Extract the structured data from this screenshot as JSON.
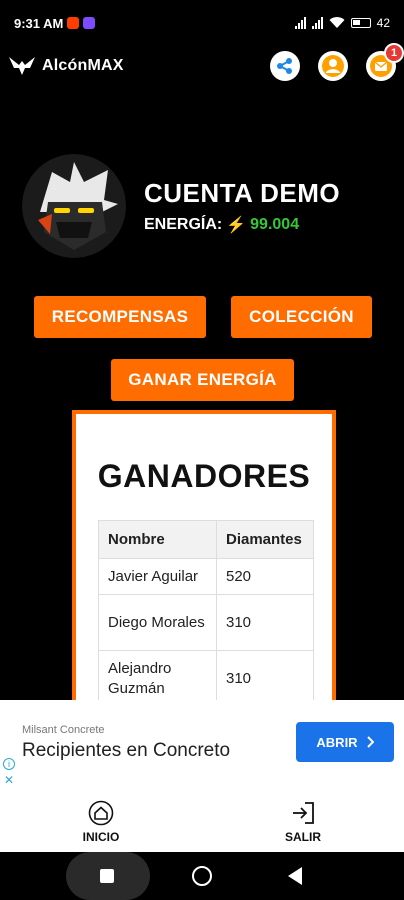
{
  "status_bar": {
    "time": "9:31 AM",
    "battery": "42"
  },
  "header": {
    "app_name": "AlcónMAX",
    "notification_count": "1"
  },
  "profile": {
    "name": "CUENTA DEMO",
    "energy_label": "ENERGÍA:",
    "energy_value": "99.004"
  },
  "buttons": {
    "rewards": "RECOMPENSAS",
    "collection": "COLECCIÓN",
    "earn_energy": "GANAR ENERGÍA"
  },
  "winners": {
    "title": "GANADORES",
    "columns": [
      "Nombre",
      "Diamantes"
    ],
    "rows": [
      {
        "name": "Javier Aguilar",
        "diamonds": "520"
      },
      {
        "name": "Diego Morales",
        "diamonds": "310"
      },
      {
        "name": "Alejandro Guzmán",
        "diamonds": "310"
      }
    ]
  },
  "ad": {
    "advertiser": "Milsant Concrete",
    "headline": "Recipientes en Concreto",
    "cta": "ABRIR"
  },
  "bottom_nav": {
    "home": "INICIO",
    "exit": "SALIR"
  },
  "colors": {
    "accent": "#ff6d00",
    "energy_value": "#34c934",
    "ad_button": "#1a73e8",
    "badge": "#e53935"
  }
}
